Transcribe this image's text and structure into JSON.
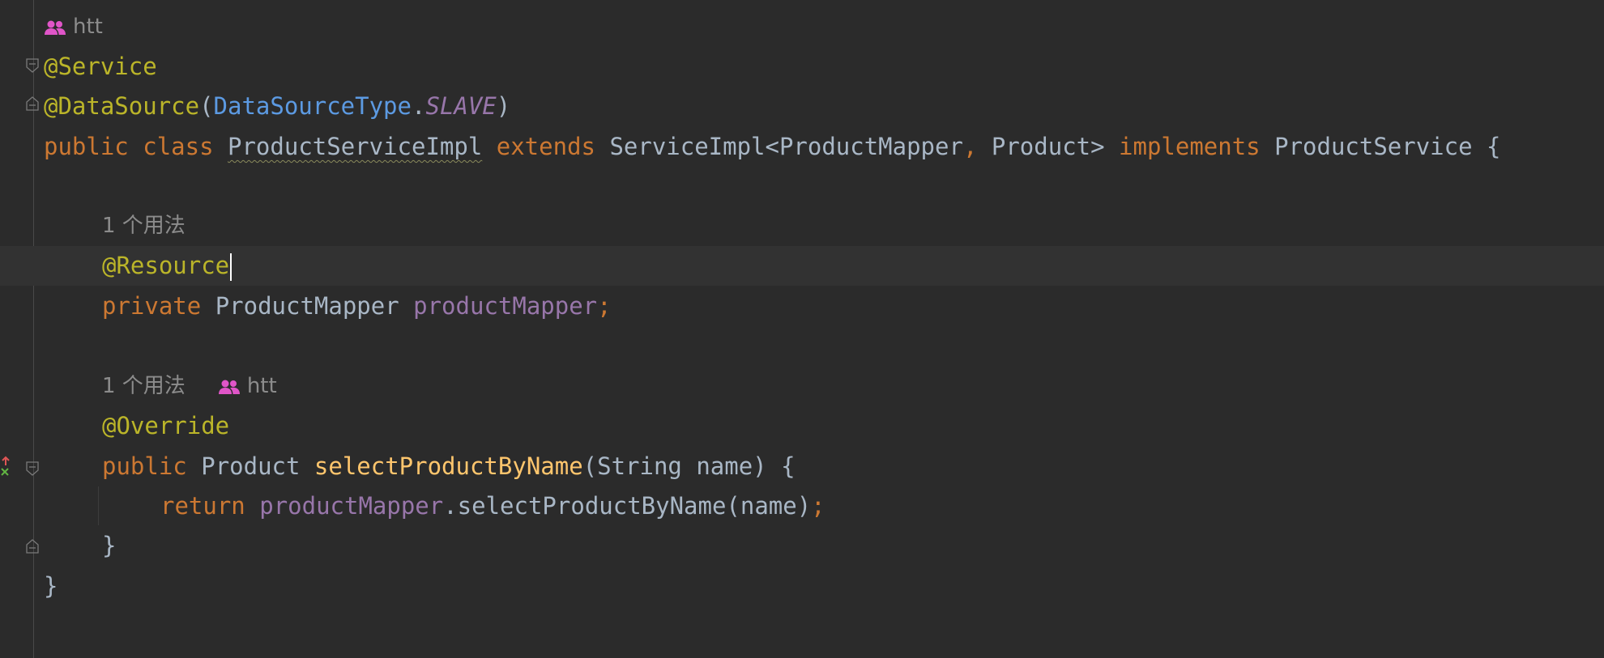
{
  "editor": {
    "author_hint_top": "htt",
    "lines": {
      "ann_service": "@Service",
      "ann_datasource": "@DataSource",
      "ds_open": "(",
      "ds_type": "DataSourceType",
      "ds_dot": ".",
      "ds_const": "SLAVE",
      "ds_close": ")",
      "kw_public": "public",
      "kw_class": "class",
      "class_name": "ProductServiceImpl",
      "kw_extends": "extends",
      "super_type": "ServiceImpl<ProductMapper",
      "comma": ",",
      "super_type_2": "Product>",
      "kw_implements": "implements",
      "iface": "ProductService {",
      "usage_hint_1": "1 个用法",
      "ann_resource": "@Resource",
      "kw_private": "private",
      "field_type": "ProductMapper",
      "field_name": "productMapper",
      "semicolon": ";",
      "usage_hint_2": "1 个用法",
      "author_hint_2": "htt",
      "ann_override": "@Override",
      "kw_public_2": "public",
      "ret_type": "Product",
      "method_name": "selectProductByName",
      "params": "(String name) {",
      "kw_return": "return",
      "call_target": "productMapper",
      "call_rest": ".selectProductByName(name)",
      "semicolon_2": ";",
      "close_method": "}",
      "close_class": "}"
    }
  },
  "colors": {
    "background": "#2b2b2b",
    "keyword": "#cc7832",
    "annotation": "#bbb529",
    "field": "#9876aa",
    "method": "#ffc66d",
    "type_ref": "#5c9ae2",
    "text": "#a9b7c6",
    "hint": "#8c8c8c",
    "people_icon": "#e055c8"
  }
}
